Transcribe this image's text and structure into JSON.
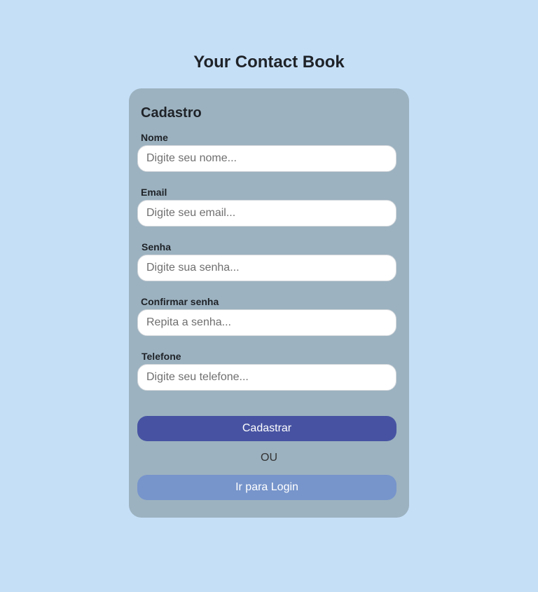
{
  "page": {
    "title": "Your Contact Book"
  },
  "form": {
    "title": "Cadastro",
    "fields": [
      {
        "label": "Nome",
        "placeholder": "Digite seu nome..."
      },
      {
        "label": "Email",
        "placeholder": "Digite seu email..."
      },
      {
        "label": "Senha",
        "placeholder": "Digite sua senha..."
      },
      {
        "label": "Confirmar senha",
        "placeholder": "Repita a senha..."
      },
      {
        "label": "Telefone",
        "placeholder": "Digite seu telefone..."
      }
    ],
    "submit_label": "Cadastrar",
    "divider": "OU",
    "login_label": "Ir para Login"
  },
  "colors": {
    "background": "#c5dff7",
    "card": "#9cb2c0",
    "primary_button": "#4753a2",
    "secondary_button": "#7795cb"
  }
}
